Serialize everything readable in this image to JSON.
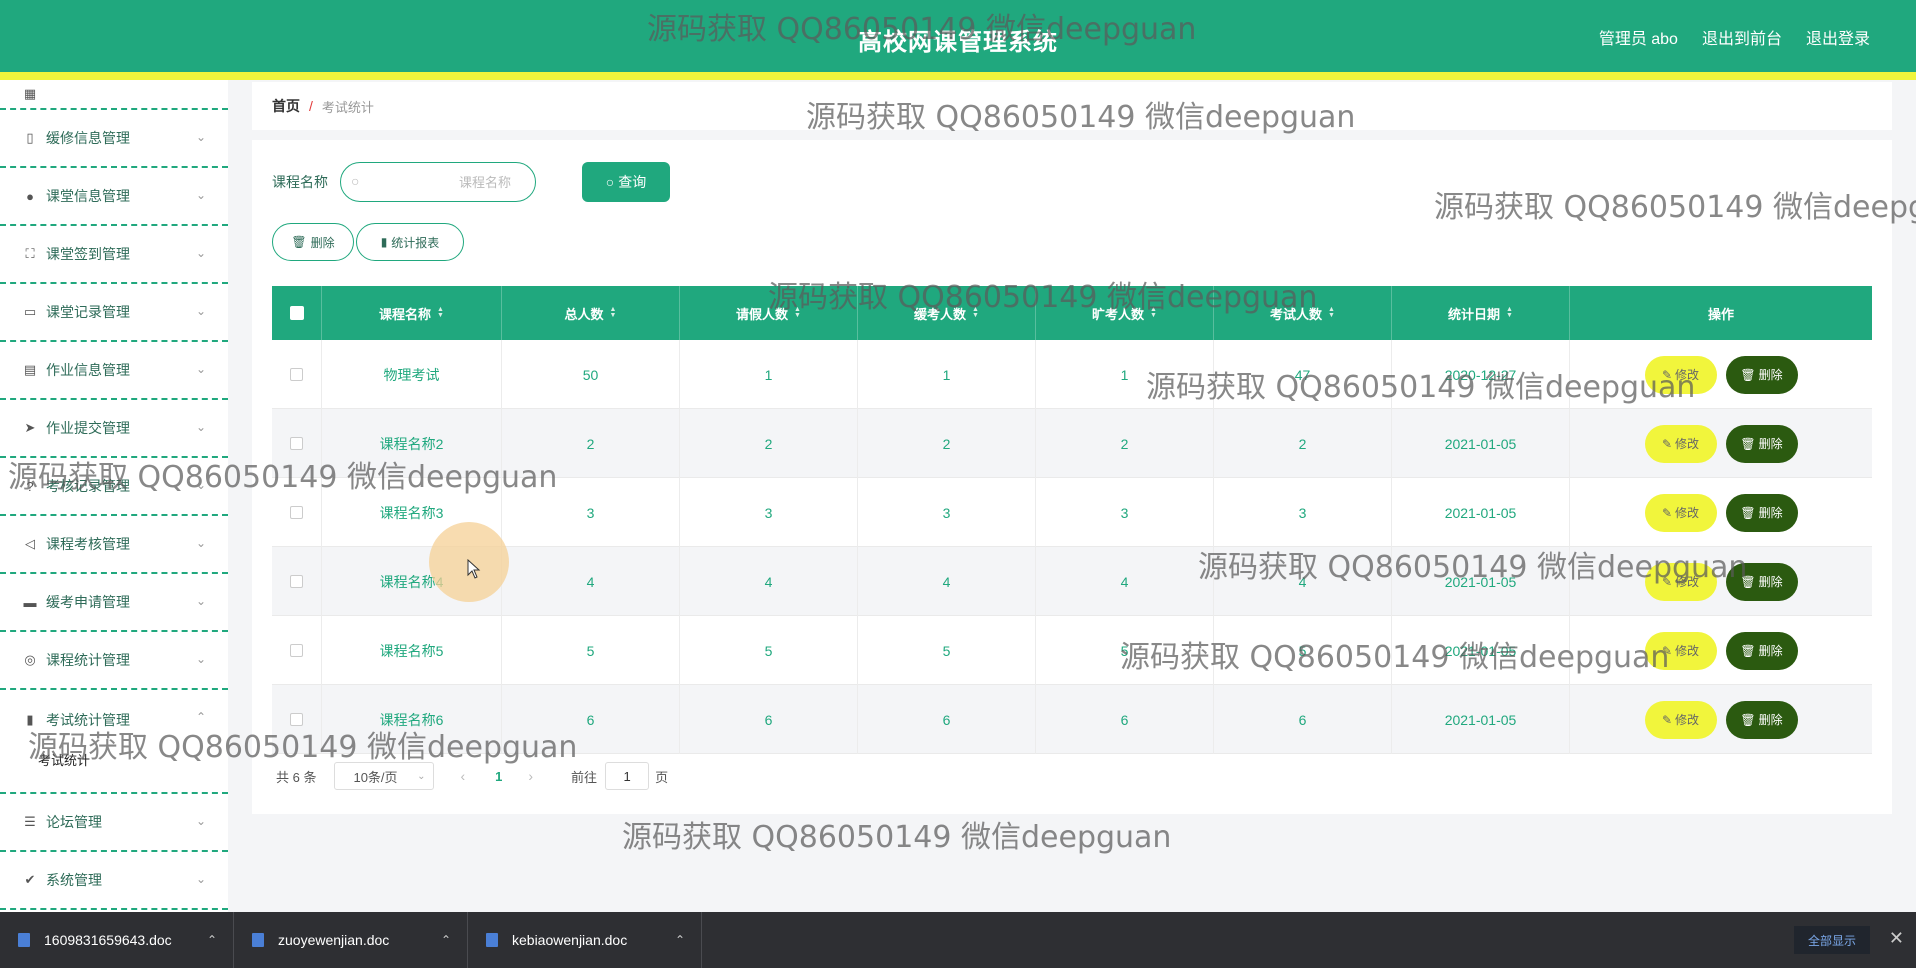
{
  "header": {
    "title": "高校网课管理系统",
    "links": [
      "管理员 abo",
      "退出到前台",
      "退出登录"
    ],
    "color": "#20a87e",
    "stripe_color": "#f1f53c"
  },
  "sidebar": {
    "items": [
      {
        "label": "",
        "icon": "grid-icon"
      },
      {
        "label": "缓修信息管理",
        "icon": "phone-icon"
      },
      {
        "label": "课堂信息管理",
        "icon": "bulb-icon"
      },
      {
        "label": "课堂签到管理",
        "icon": "scan-icon"
      },
      {
        "label": "课堂记录管理",
        "icon": "card-icon"
      },
      {
        "label": "作业信息管理",
        "icon": "clipboard-icon"
      },
      {
        "label": "作业提交管理",
        "icon": "send-icon"
      },
      {
        "label": "考核记录管理",
        "icon": "question-icon"
      },
      {
        "label": "课程考核管理",
        "icon": "location-icon"
      },
      {
        "label": "缓考申请管理",
        "icon": "briefcase-icon"
      },
      {
        "label": "课程统计管理",
        "icon": "compass-icon"
      },
      {
        "label": "考试统计管理",
        "icon": "chart-icon",
        "open": true,
        "sub": "考试统计"
      },
      {
        "label": "论坛管理",
        "icon": "sliders-icon"
      },
      {
        "label": "系统管理",
        "icon": "check-icon"
      }
    ]
  },
  "breadcrumb": {
    "home": "首页",
    "separator": "/",
    "current": "考试统计"
  },
  "search": {
    "label": "课程名称",
    "placeholder": "课程名称",
    "button": "查询"
  },
  "toolbar": {
    "delete": "删除",
    "report": "统计报表"
  },
  "table": {
    "headers": [
      "课程名称",
      "总人数",
      "请假人数",
      "缓考人数",
      "旷考人数",
      "考试人数",
      "统计日期",
      "操作"
    ],
    "rows": [
      {
        "name": "物理考试",
        "total": "50",
        "leave": "1",
        "deferred": "1",
        "absent": "1",
        "exam": "47",
        "date": "2020-12-27"
      },
      {
        "name": "课程名称2",
        "total": "2",
        "leave": "2",
        "deferred": "2",
        "absent": "2",
        "exam": "2",
        "date": "2021-01-05"
      },
      {
        "name": "课程名称3",
        "total": "3",
        "leave": "3",
        "deferred": "3",
        "absent": "3",
        "exam": "3",
        "date": "2021-01-05"
      },
      {
        "name": "课程名称4",
        "total": "4",
        "leave": "4",
        "deferred": "4",
        "absent": "4",
        "exam": "4",
        "date": "2021-01-05"
      },
      {
        "name": "课程名称5",
        "total": "5",
        "leave": "5",
        "deferred": "5",
        "absent": "5",
        "exam": "5",
        "date": "2021-01-05"
      },
      {
        "name": "课程名称6",
        "total": "6",
        "leave": "6",
        "deferred": "6",
        "absent": "6",
        "exam": "6",
        "date": "2021-01-05"
      }
    ],
    "edit_label": "修改",
    "delete_label": "删除"
  },
  "pagination": {
    "total": "共 6 条",
    "page_size": "10条/页",
    "current": "1",
    "goto": "前往",
    "goto_value": "1",
    "page_word": "页"
  },
  "taskbar": {
    "downloads": [
      "1609831659643.doc",
      "zuoyewenjian.doc",
      "kebiaowenjian.doc"
    ],
    "show_all": "全部显示"
  },
  "watermark": "源码获取 QQ86050149 微信deepguan",
  "watermark_cut": "源码获取 QQ86050149 微信deepg"
}
